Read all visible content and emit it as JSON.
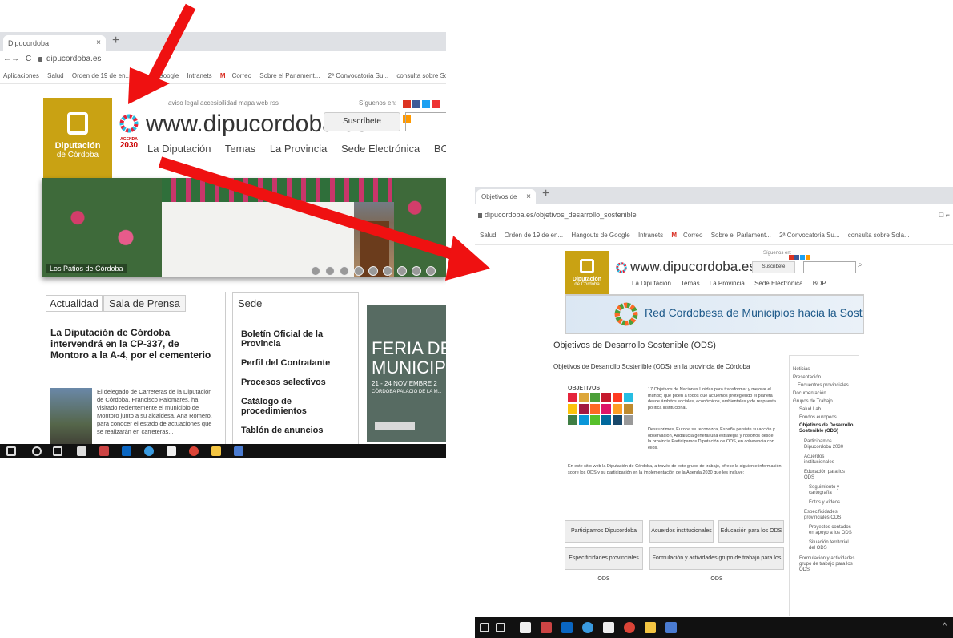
{
  "left_screen": {
    "tab_title": "Dipucordoba",
    "tab_close": "×",
    "new_tab": "+",
    "nav_back": "←",
    "nav_forward": "→",
    "reload": "C",
    "url": "dipucordoba.es",
    "bookmarks": [
      "Aplicaciones",
      "Salud",
      "Orden de 19 de en...",
      "...s de Google",
      "Intranets",
      "Correo",
      "Sobre el Parlament...",
      "2ª Convocatoria Su...",
      "consulta sobre Sol..."
    ],
    "top_links": "aviso legal  accesibilidad  mapa web  rss",
    "siguenos": "Síguenos en:",
    "subscribe_label": "Suscríbete",
    "logo_line1": "Diputación",
    "logo_line2": "de Córdoba",
    "agenda_label": "AGENDA",
    "agenda_year": "2030",
    "site_url": "www.dipucordoba.es",
    "nav": [
      "La Diputación",
      "Temas",
      "La Provincia",
      "Sede Electrónica",
      "BOP"
    ],
    "banner_caption": "Los Patios de Córdoba",
    "tabs": [
      "Actualidad",
      "Sala de Prensa"
    ],
    "news_title": "La Diputación de Córdoba intervendrá en la CP-337, de Montoro a la A-4, por el cementerio",
    "news_body": "El delegado de Carreteras de la Diputación de Córdoba, Francisco Palomares, ha visitado recientemente el municipio de Montoro junto a su alcaldesa, Ana Romero, para conocer el estado de actuaciones que se realizarán en carreteras...",
    "sede_title": "Sede",
    "sede_links": [
      "Boletín Oficial de la Provincia",
      "Perfil del Contratante",
      "Procesos selectivos",
      "Catálogo de procedimientos",
      "Tablón de anuncios"
    ],
    "feria_line1": "FERIA DE LO",
    "feria_line2": "MUNICIPIO",
    "feria_dates": "21 - 24 NOVIEMBRE 2",
    "feria_place": "CÓRDOBA PALACIO DE LA M..."
  },
  "right_screen": {
    "tab_title": "Objetivos de De...",
    "tab_close": "×",
    "new_tab": "+",
    "url": "dipucordoba.es/objetivos_desarrollo_sostenible",
    "window_controls": "□  ⌐",
    "bookmarks": [
      "Salud",
      "Orden de 19 de en...",
      "Hangouts de Google",
      "Intranets",
      "Correo",
      "Sobre el Parlament...",
      "2ª Convocatoria Su...",
      "consulta sobre Sola..."
    ],
    "siguenos": "Síguenos en:",
    "subscribe_label": "Suscríbete",
    "logo_line1": "Diputación",
    "logo_line2": "de Córdoba",
    "site_url": "www.dipucordoba.es",
    "nav": [
      "La Diputación",
      "Temas",
      "La Provincia",
      "Sede Electrónica",
      "BOP"
    ],
    "banner_title": "Red Cordobesa de Municipios hacia la Sostenibilidad",
    "page_heading": "Objetivos de Desarrollo Sostenible (ODS)",
    "sub_heading": "Objetivos de Desarrollo Sostenible (ODS) en la provincia de Córdoba",
    "ods_brand": "OBJETIVOS",
    "para1": "17 Objetivos de Naciones Unidas para transformar y mejorar el mundo; que piden a todos que actuemos protegiendo el planeta desde ámbitos sociales, económicos, ambientales y de respuesta política institucional.",
    "para2": "Descubrimos, Europa se reconozca, España persiste su acción y observación, Andalucía general una estrategia y nosotros desde la provincia Participamos Diputación de ODS, en coherencia con ellos.",
    "para3": "En este sitio web la Diputación de Córdoba, a través de este grupo de trabajo, ofrece la siguiente información sobre los ODS y su participación en la implementación de la Agenda 2030 que les incluye:",
    "buttons": [
      "Participamos Dipucordoba 2030",
      "Acuerdos institucionales",
      "Educación para los ODS",
      "Especificidades provinciales ODS",
      "Formulación y actividades grupo de trabajo para los ODS"
    ],
    "side_menu": [
      "Noticias",
      "Presentación",
      "Encuentros provinciales",
      "Documentación",
      "Grupos de Trabajo",
      "Salud Lab",
      "Fondos europeos",
      "Objetivos de Desarrollo Sostenible (ODS)",
      "Participamos Dipucordoba 2030",
      "Acuerdos institucionales",
      "Educación para los ODS",
      "Seguimiento y cartografía",
      "Fotos y vídeos",
      "Especificidades provinciales ODS",
      "Proyectos contados en apoyo a los ODS",
      "Situación territorial del ODS",
      "Formulación y actividades grupo de trabajo para los ODS"
    ]
  },
  "taskbar_icons": [
    "windows-icon",
    "search-icon",
    "task-view-icon",
    "store-icon",
    "mail-icon",
    "linkedin-icon",
    "edge-icon",
    "file-icon",
    "chrome-icon",
    "folder-icon",
    "document-icon"
  ],
  "colors": {
    "logo_gold": "#c9a213",
    "arrow_red": "#ef1111",
    "taskbar": "#111111",
    "banner_blue": "#dbe7f3"
  }
}
